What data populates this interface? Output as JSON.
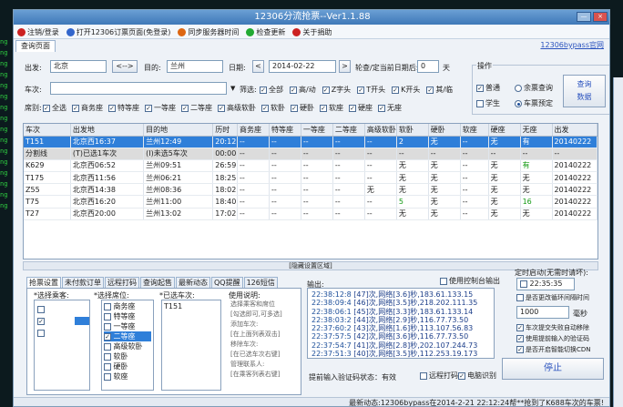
{
  "window": {
    "title": "12306分流抢票--Ver1.1.88"
  },
  "menu": [
    {
      "label": "注销/登录",
      "icon": "logout-icon",
      "color": "#cc2222"
    },
    {
      "label": "打开12306订票页面(免登录)",
      "icon": "open-page-icon",
      "color": "#3366cc"
    },
    {
      "label": "同步服务器时间",
      "icon": "clock-sync-icon",
      "color": "#dd6611"
    },
    {
      "label": "检查更新",
      "icon": "check-update-icon",
      "color": "#22aa33"
    },
    {
      "label": "关于捐助",
      "icon": "donate-icon",
      "color": "#cc2222"
    }
  ],
  "tabs": {
    "query": "查询页面"
  },
  "support_link": "12306bypass官网",
  "query": {
    "from_label": "出发:",
    "from_value": "北京",
    "swap_label": "<-->",
    "to_label": "目的:",
    "to_value": "兰州",
    "date_label": "日期:",
    "date_value": "2014-02-22",
    "date_prev": "<",
    "date_next": ">",
    "rotate_label": "轮查/定当前日期后:",
    "rotate_value": "0",
    "rotate_unit": "天",
    "train_label": "车次:",
    "filter_label": "筛选:",
    "filters": [
      "全部",
      "高/动",
      "Z字头",
      "T开头",
      "K开头",
      "其/临"
    ],
    "seat_label": "席别:",
    "seats": [
      "全选",
      "商务座",
      "特等座",
      "一等座",
      "二等座",
      "高级软卧",
      "软卧",
      "硬卧",
      "软座",
      "硬座",
      "无座"
    ]
  },
  "actions": {
    "label": "操作",
    "normal": "普通",
    "remaining": "余票查询",
    "student": "学生",
    "reserve": "车票预定",
    "query_button": "查询\n数据"
  },
  "table": {
    "headers": [
      "车次",
      "出发地",
      "目的地",
      "历时",
      "商务座",
      "特等座",
      "一等座",
      "二等座",
      "高级软卧",
      "软卧",
      "硬卧",
      "软座",
      "硬座",
      "无座",
      "出发"
    ],
    "rows": [
      {
        "cls": "sel",
        "cells": [
          "T151",
          "北京西16:37",
          "兰州12:49",
          "20:12",
          "--",
          "--",
          "--",
          "--",
          "--",
          "2",
          "无",
          "--",
          "无",
          "有",
          "20140222"
        ]
      },
      {
        "cls": "grp",
        "cells": [
          "分割线",
          "(T)已选1车次",
          "(I)未选5车次",
          "00:00",
          "--",
          "--",
          "--",
          "--",
          "--",
          "--",
          "--",
          "--",
          "--",
          "--",
          "--"
        ]
      },
      {
        "cls": "",
        "cells": [
          "K629",
          "北京西06:52",
          "兰州09:51",
          "26:59",
          "--",
          "--",
          "--",
          "--",
          "--",
          "无",
          "无",
          "--",
          "无",
          "有",
          "20140222"
        ]
      },
      {
        "cls": "",
        "cells": [
          "T175",
          "北京西11:56",
          "兰州06:21",
          "18:25",
          "--",
          "--",
          "--",
          "--",
          "--",
          "无",
          "无",
          "--",
          "无",
          "无",
          "20140222"
        ]
      },
      {
        "cls": "",
        "cells": [
          "Z55",
          "北京西14:38",
          "兰州08:36",
          "18:02",
          "--",
          "--",
          "--",
          "--",
          "无",
          "无",
          "无",
          "--",
          "无",
          "无",
          "20140222"
        ]
      },
      {
        "cls": "",
        "cells": [
          "T75",
          "北京西16:20",
          "兰州11:00",
          "18:40",
          "--",
          "--",
          "--",
          "--",
          "--",
          "5",
          "无",
          "--",
          "无",
          "16",
          "20140222"
        ]
      },
      {
        "cls": "",
        "cells": [
          "T27",
          "北京西20:00",
          "兰州13:02",
          "17:02",
          "--",
          "--",
          "--",
          "--",
          "--",
          "无",
          "无",
          "--",
          "无",
          "无",
          "20140222"
        ]
      }
    ]
  },
  "hidebar": "[隐藏设置区域]",
  "bottom_tabs": [
    "抢票设置",
    "未付款订单",
    "远程打码",
    "查询起售",
    "最新动态",
    "QQ提醒",
    "126短信"
  ],
  "settings": {
    "passenger_label": "*选择乘客:",
    "seat_label": "*选择席位:",
    "seat_options": [
      "商务座",
      "特等座",
      "一等座",
      "二等座",
      "高级软卧",
      "软卧",
      "硬卧",
      "软座"
    ],
    "train_label": "*已选车次:",
    "train_value": "T151",
    "help_label": "使用说明:",
    "help_text": [
      "选择乘客和席位",
      "[勾选即可,可多选]",
      "添加车次:",
      "[在上面列表双击]",
      "移除车次:",
      "[在已选车次右键]",
      "管理联系人:",
      "[在乘客列表右键]"
    ]
  },
  "output": {
    "label": "输出:",
    "remote_label": "使用控制台输出",
    "lines": [
      [
        "22:38:12:8",
        "[47]次,网络[3.6]秒,183.61.133.15"
      ],
      [
        "22:38:09:4",
        "[46]次,网络[3.5]秒,218.202.111.35"
      ],
      [
        "22:38:06:1",
        "[45]次,网络[3.3]秒,183.61.133.14"
      ],
      [
        "22:38:03:2",
        "[44]次,网络[2.9]秒,116.77.73.50"
      ],
      [
        "22:37:60:2",
        "[43]次,网络[1.6]秒,113.107.56.83"
      ],
      [
        "22:37:57:5",
        "[42]次,网络[3.6]秒,116.77.73.50"
      ],
      [
        "22:37:54:7",
        "[41]次,网络[2.8]秒,202.107.244.73"
      ],
      [
        "22:37:51:3",
        "[40]次,网络[3.5]秒,112.253.19.173"
      ]
    ],
    "captcha_label": "提前输入验证码状态：有效",
    "remote_code": "远程打码",
    "auto_code": "电脑识别"
  },
  "timer": {
    "label": "定时启动(无需时请坏):",
    "time": "22:35:35",
    "auto_refresh": "是否更改循环间隔时间",
    "interval": "1000",
    "interval_unit": "毫秒",
    "opt1": "车次提交失败自动移除",
    "opt2": "使用提前输入的验证码",
    "opt3": "是否开启智能切换CDN",
    "stop_button": "停止"
  },
  "status": "最新动态:12306bypass在2014-2-21 22:12:24帮**抢到了K688车次的车票!",
  "terminal_lines": [
    "ng",
    "ng",
    "ng",
    "ng",
    "ng",
    "ng",
    "ng",
    "ng",
    "ng",
    "ng",
    "ng",
    "ng",
    "ng",
    "ng",
    "ng",
    "ng"
  ]
}
